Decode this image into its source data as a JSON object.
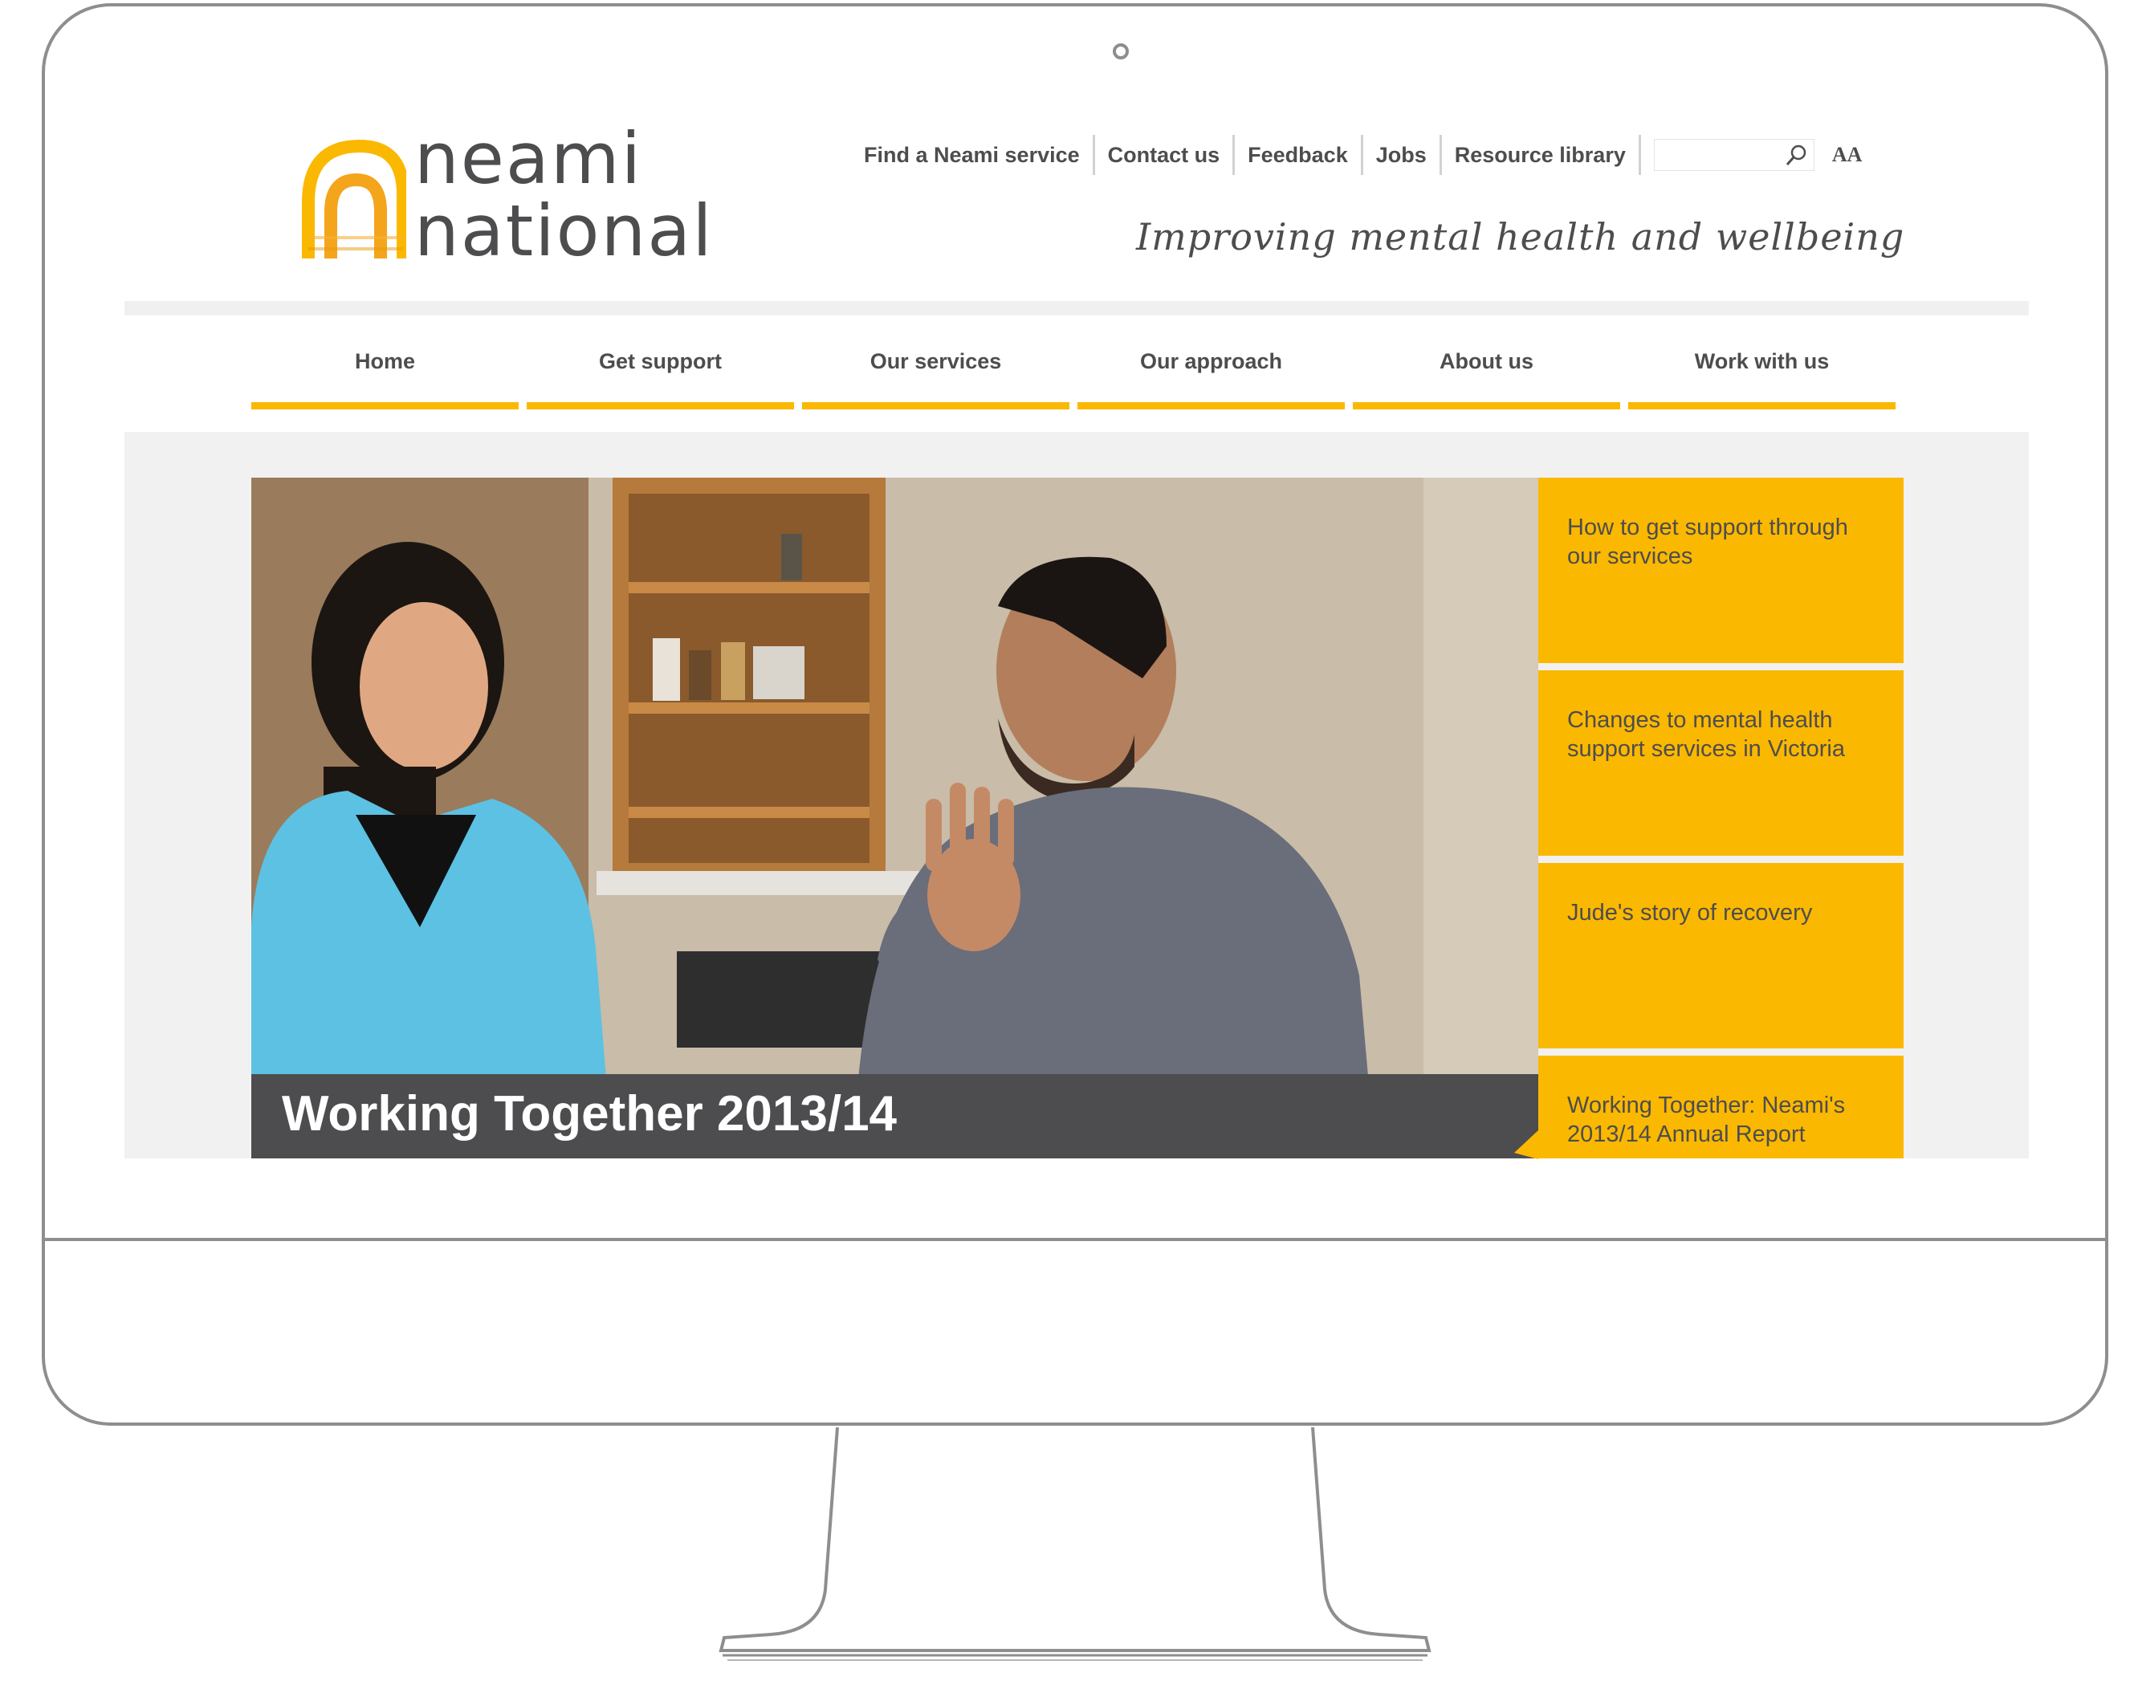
{
  "logo": {
    "line1": "neami",
    "line2": "national"
  },
  "top_links": [
    "Find a Neami service",
    "Contact us",
    "Feedback",
    "Jobs",
    "Resource library"
  ],
  "search": {
    "placeholder": ""
  },
  "text_size_label": "AA",
  "tagline": "Improving mental health and wellbeing",
  "nav": [
    "Home",
    "Get support",
    "Our services",
    "Our approach",
    "About us",
    "Work with us"
  ],
  "hero": {
    "caption": "Working Together 2013/14"
  },
  "sidebar": [
    "How to get support through our services",
    "Changes to mental health support services in Victoria",
    "Jude's story of recovery",
    "Working Together: Neami's 2013/14 Annual Report"
  ],
  "colors": {
    "accent": "#fbb800",
    "text": "#4d4d4f",
    "frame": "#8e8e8e",
    "caption_bg": "#4d4d4f"
  }
}
